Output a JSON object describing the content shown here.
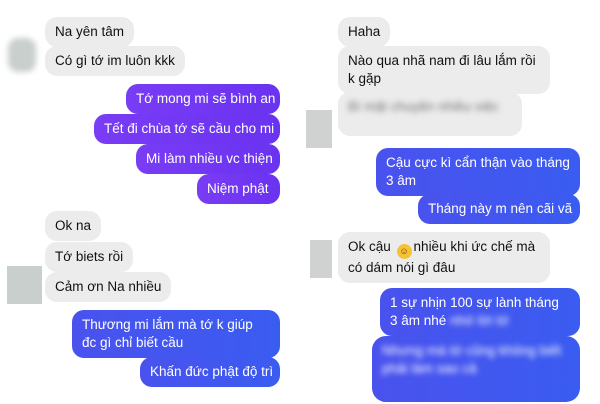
{
  "left": {
    "messages": [
      {
        "text": "Na yên tâm"
      },
      {
        "text": "Có gì tớ im luôn kkk"
      },
      {
        "text": "Tớ mong mi sẽ bình an"
      },
      {
        "text": "Tết đi chùa tớ sẽ cầu cho mi"
      },
      {
        "text": "Mi làm nhiều vc thiện"
      },
      {
        "text": "Niệm phật"
      },
      {
        "text": "Ok na"
      },
      {
        "text": "Tớ biets rồi"
      },
      {
        "text": "Cảm ơn Na nhiều"
      },
      {
        "text": "Thương mi lắm mà tớ k giúp đc gì chỉ biết cầu"
      },
      {
        "text": "Khấn đức phật độ trì"
      }
    ]
  },
  "right": {
    "messages": [
      {
        "text": "Haha"
      },
      {
        "text": "Nào qua nhã nam đi lâu lắm rồi k gặp"
      },
      {
        "text": "Bí mật chuyện nhiều việc"
      },
      {
        "text": "Cậu cực kì cẩn thận vào tháng 3 âm"
      },
      {
        "text": "Tháng này m nên cãi vã"
      },
      {
        "text": "Ok cậu",
        "text2": "nhiều khi ức chế mà có dám nói gì đâu"
      },
      {
        "text": "1 sự nhịn 100 sự lành tháng 3 âm nhé",
        "hidden": "nhớ lời tớ"
      },
      {
        "text": "Nhưng mà tớ cũng không biết phải làm sao cả"
      }
    ],
    "emoji_icon": "grinning-sweat-emoji"
  },
  "colors": {
    "incoming_bubble": "#ececec",
    "outgoing_purple": "#7a3cf5",
    "outgoing_blue": "#3a5cf0",
    "avatar_placeholder": "#c9cfcc"
  }
}
